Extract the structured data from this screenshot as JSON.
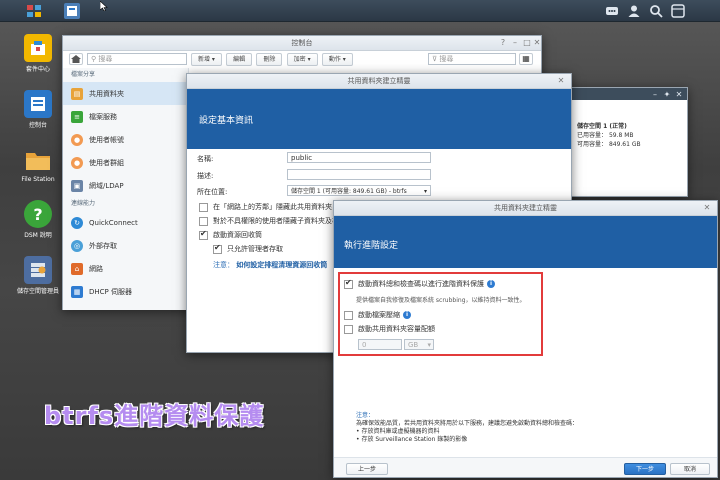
{
  "desktop": {
    "icons": [
      {
        "label": "套件中心",
        "icon": "package-icon",
        "color": "#f2b800"
      },
      {
        "label": "控制台",
        "icon": "control-panel-icon",
        "color": "#2b77c8"
      },
      {
        "label": "File Station",
        "icon": "folder-icon",
        "color": "#e8a33a"
      },
      {
        "label": "DSM 說明",
        "icon": "help-icon",
        "color": "#3aa53a"
      },
      {
        "label": "儲存空間管理員",
        "icon": "storage-icon",
        "color": "#4d6da0"
      }
    ]
  },
  "control_panel": {
    "title": "控制台",
    "search_placeholder": "搜尋",
    "toolbar": {
      "new": "新增",
      "edit": "編輯",
      "delete": "刪除",
      "encrypt": "加密",
      "action": "動作",
      "filter_placeholder": "搜尋"
    },
    "sidebar": {
      "section1": "檔案分享",
      "items1": [
        {
          "label": "共用資料夾",
          "icon": "shared-folder-icon",
          "color": "#e8a33a",
          "active": true
        },
        {
          "label": "檔案服務",
          "icon": "file-services-icon",
          "color": "#3aa53a"
        },
        {
          "label": "使用者帳號",
          "icon": "user-icon",
          "color": "#f29a52"
        },
        {
          "label": "使用者群組",
          "icon": "group-icon",
          "color": "#f29a52"
        },
        {
          "label": "網域/LDAP",
          "icon": "domain-icon",
          "color": "#6a84a6"
        }
      ],
      "section2": "連線能力",
      "items2": [
        {
          "label": "QuickConnect",
          "icon": "quickconnect-icon",
          "color": "#2e8ad6"
        },
        {
          "label": "外部存取",
          "icon": "external-access-icon",
          "color": "#4aa0d8"
        },
        {
          "label": "網路",
          "icon": "network-icon",
          "color": "#e06a2a"
        },
        {
          "label": "DHCP 伺服器",
          "icon": "dhcp-icon",
          "color": "#2e7bd1"
        }
      ]
    }
  },
  "storage_panel": {
    "volume": "儲存空間 1 (正常)",
    "used_label": "已用容量：",
    "used_value": "59.8 MB",
    "free_label": "可用容量：",
    "free_value": "849.61 GB"
  },
  "wizard1": {
    "title": "共用資料夾建立精靈",
    "heading": "設定基本資訊",
    "name_label": "名稱:",
    "name_value": "public",
    "desc_label": "描述:",
    "location_label": "所在位置:",
    "location_value": "儲存空間 1 (可用容量: 849.61 GB) - btrfs",
    "opt_hide_network": "在「網路上的芳鄰」隱藏此共用資料夾",
    "opt_hide_subfolders": "對於不具權限的使用者隱藏子資料夾及檔案",
    "opt_recycle": "啟動資源回收筒",
    "opt_admin_only": "只允許管理者存取",
    "note_label": "注意：",
    "note_link": "如何設定排程清理資源回收筒"
  },
  "wizard2": {
    "title": "共用資料夾建立精靈",
    "heading": "執行進階設定",
    "opt_checksum": "啟動資料總和檢查碼以進行進階資料保護",
    "checksum_desc": "提供檔案自我修復及檔案系統 scrubbing，以維持資料一致性。",
    "opt_compress": "啟動檔案壓縮",
    "opt_quota": "啟動共用資料夾容量配額",
    "quota_value": "0",
    "quota_unit": "GB",
    "note_title": "注意：",
    "note_body": "為確保效能品質，若共用資料夾將用於以下服務，建議您避免啟動資料總和檢查碼：",
    "note_items": [
      "存放資料庫或虛擬機器的資料",
      "存放 Surveillance Station 錄製的影像"
    ],
    "back": "上一步",
    "next": "下一步",
    "cancel": "取消"
  },
  "caption": "btrfs進階資料保護"
}
